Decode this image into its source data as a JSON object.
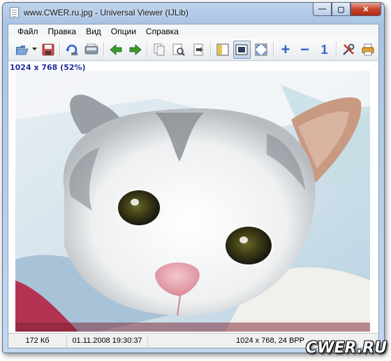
{
  "window": {
    "title": "www.CWER.ru.jpg - Universal Viewer (IJLib)",
    "buttons": {
      "minimize": "—",
      "maximize": "▢",
      "close": "✕"
    }
  },
  "menu": [
    "Файл",
    "Правка",
    "Вид",
    "Опции",
    "Справка"
  ],
  "toolbar": {
    "items": [
      "open-icon",
      "dropdown-arrow-icon",
      "save-icon",
      "reload-icon",
      "scanner-icon",
      "back-arrow-icon",
      "forward-arrow-icon",
      "copy-icon",
      "zoom-page-icon",
      "export-icon",
      "panel-left-icon",
      "fit-window-icon",
      "fullscreen-icon",
      "zoom-in-icon",
      "zoom-out-icon",
      "actual-size-icon",
      "options-tools-icon",
      "print-icon"
    ],
    "zoom_in_glyph": "+",
    "zoom_out_glyph": "−",
    "actual_size_glyph": "1",
    "active_item": "fit-window-icon"
  },
  "viewer": {
    "dimensions_label": "1024 x 768 (52%)"
  },
  "statusbar": {
    "file_size": "172 Кб",
    "date": "01.11.2008 19:30:37",
    "resolution": "1024 x 768, 24 BPP"
  },
  "watermark": "CWER.RU",
  "colors": {
    "title_bar": "#a9c4e3",
    "close_button": "#c6452f",
    "dimensions_label": "#1f2f9a",
    "toolbar_green": "#3a9a2a",
    "toolbar_blue": "#2f64c9"
  }
}
